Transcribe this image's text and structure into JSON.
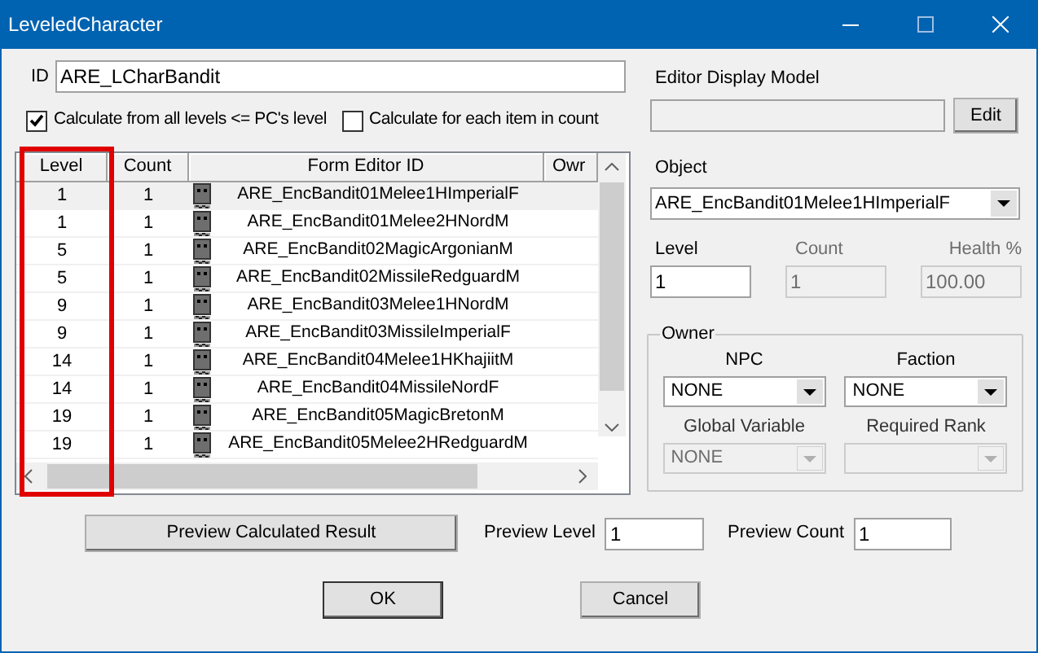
{
  "window": {
    "title": "LeveledCharacter"
  },
  "id_field": {
    "label": "ID",
    "value": "ARE_LCharBandit"
  },
  "options": [
    {
      "label": "Calculate from all levels <= PC's level",
      "checked": true
    },
    {
      "label": "Calculate for each item in count",
      "checked": false
    }
  ],
  "list": {
    "columns": [
      "Level",
      "Count",
      "Form Editor ID",
      "Owr"
    ],
    "rows": [
      {
        "level": "1",
        "count": "1",
        "form_editor_id": "ARE_EncBandit01Melee1HImperialF",
        "selected": true
      },
      {
        "level": "1",
        "count": "1",
        "form_editor_id": "ARE_EncBandit01Melee2HNordM",
        "selected": false
      },
      {
        "level": "5",
        "count": "1",
        "form_editor_id": "ARE_EncBandit02MagicArgonianM",
        "selected": false
      },
      {
        "level": "5",
        "count": "1",
        "form_editor_id": "ARE_EncBandit02MissileRedguardM",
        "selected": false
      },
      {
        "level": "9",
        "count": "1",
        "form_editor_id": "ARE_EncBandit03Melee1HNordM",
        "selected": false
      },
      {
        "level": "9",
        "count": "1",
        "form_editor_id": "ARE_EncBandit03MissileImperialF",
        "selected": false
      },
      {
        "level": "14",
        "count": "1",
        "form_editor_id": "ARE_EncBandit04Melee1HKhajiitM",
        "selected": false
      },
      {
        "level": "14",
        "count": "1",
        "form_editor_id": "ARE_EncBandit04MissileNordF",
        "selected": false
      },
      {
        "level": "19",
        "count": "1",
        "form_editor_id": "ARE_EncBandit05MagicBretonM",
        "selected": false
      },
      {
        "level": "19",
        "count": "1",
        "form_editor_id": "ARE_EncBandit05Melee2HRedguardM",
        "selected": false
      }
    ]
  },
  "editor_display_model": {
    "label": "Editor Display Model",
    "button": "Edit"
  },
  "object": {
    "label": "Object",
    "value": "ARE_EncBandit01Melee1HImperialF"
  },
  "fields": [
    {
      "label": "Level",
      "value": "1",
      "disabled": false
    },
    {
      "label": "Count",
      "value": "1",
      "disabled": true
    },
    {
      "label": "Health %",
      "value": "100.00",
      "disabled": true
    }
  ],
  "owner": {
    "title": "Owner",
    "dropdowns": [
      {
        "label": "NPC",
        "value": "NONE",
        "disabled": false
      },
      {
        "label": "Faction",
        "value": "NONE",
        "disabled": false
      },
      {
        "label": "Global Variable",
        "value": "NONE",
        "disabled": true
      },
      {
        "label": "Required Rank",
        "disabled": true
      }
    ]
  },
  "preview": {
    "button": "Preview Calculated Result",
    "level_label": "Preview Level",
    "level_value": "1",
    "count_label": "Preview Count",
    "count_value": "1"
  },
  "buttons": [
    "OK",
    "Cancel"
  ]
}
